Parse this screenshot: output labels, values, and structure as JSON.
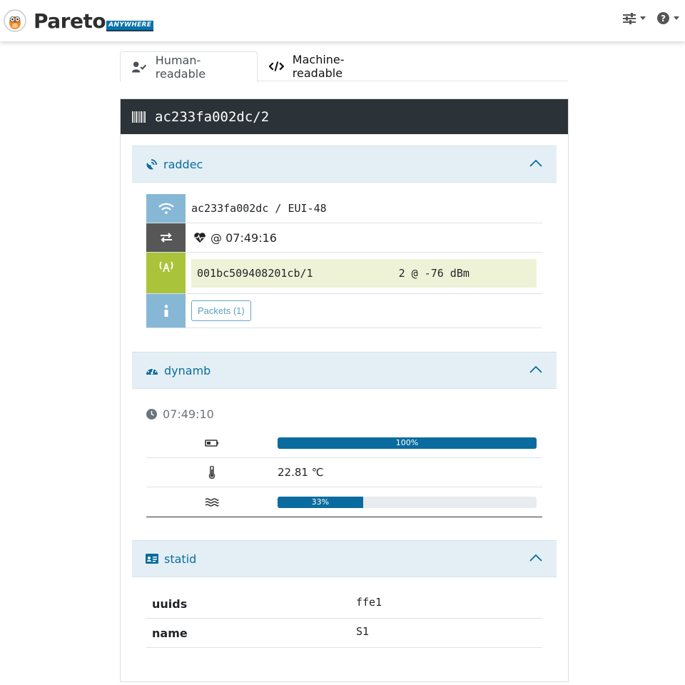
{
  "brand": {
    "name": "Pareto",
    "tag": "ANYWHERE"
  },
  "nav": {
    "settings_icon": "sliders-icon",
    "help_icon": "question-circle-icon"
  },
  "tabs": [
    {
      "label": "Human-readable",
      "icon": "user-check-icon",
      "active": true
    },
    {
      "label": "Machine-readable",
      "icon": "code-icon",
      "active": false
    }
  ],
  "device": {
    "id": "ac233fa002dc/2",
    "icon": "barcode-icon"
  },
  "raddec": {
    "title": "raddec",
    "transmitter": "ac233fa002dc / EUI-48",
    "event_time": "@ 07:49:16",
    "receiver": "001bc509408201cb/1",
    "rssi": "2 @ -76 dBm",
    "packets_button": "Packets (1)",
    "colors": {
      "wifi": "#86b8d6",
      "exchange": "#575757",
      "antenna": "#a9c43a",
      "info": "#86b8d6"
    }
  },
  "dynamb": {
    "title": "dynamb",
    "time": "07:49:10",
    "battery": {
      "percent": 100,
      "label": "100%"
    },
    "temperature": "22.81 ℃",
    "humidity": {
      "percent": 33,
      "label": "33%"
    }
  },
  "statid": {
    "title": "statid",
    "rows": [
      {
        "key": "uuids",
        "value": "ffe1"
      },
      {
        "key": "name",
        "value": "S1"
      }
    ]
  }
}
